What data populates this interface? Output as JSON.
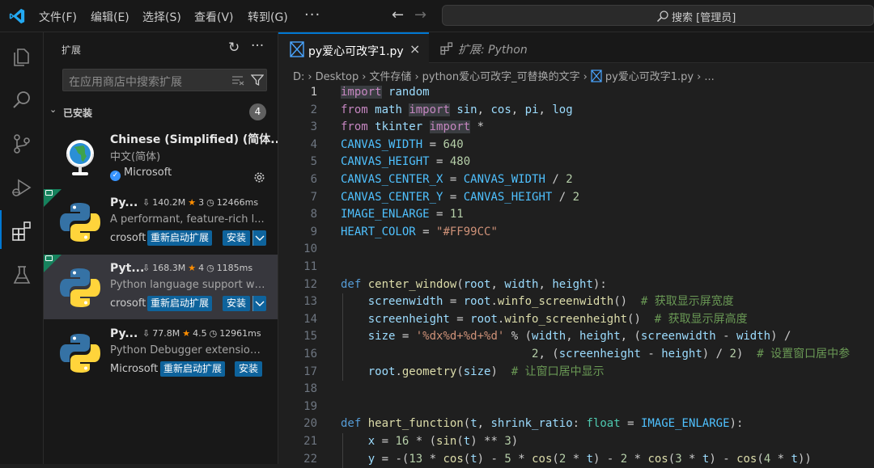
{
  "title_bar": {
    "menu": [
      "文件(F)",
      "编辑(E)",
      "选择(S)",
      "查看(V)",
      "转到(G)"
    ],
    "more": "···",
    "back_arrow": "←",
    "forward_arrow": "→",
    "search": "搜索 [管理员]"
  },
  "activity_bar": {
    "items": [
      "explorer",
      "search",
      "source-control",
      "run-and-debug",
      "extensions",
      "testing"
    ],
    "active": "extensions"
  },
  "sidebar": {
    "title": "扩展",
    "search_placeholder": "在应用商店中搜索扩展",
    "section_label": "已安装",
    "section_count": "4",
    "extensions": [
      {
        "name": "Chinese (Simplified) (简体...",
        "description": "中文(简体)",
        "publisher": "Microsoft",
        "verified": true,
        "icon": "globe-icon"
      },
      {
        "name": "Py...",
        "downloads": "140.2M",
        "rating": "3",
        "time": "12466ms",
        "description": "A performant, feature-rich l...",
        "publisher": "crosoft",
        "restart_label": "重新启动扩展",
        "install_label": "安装",
        "icon": "python-icon"
      },
      {
        "name": "Pyt...",
        "downloads": "168.3M",
        "rating": "4",
        "time": "1185ms",
        "description": "Python language support wi...",
        "publisher": "crosoft",
        "restart_label": "重新启动扩展",
        "install_label": "安装",
        "icon": "python-icon"
      },
      {
        "name": "Py...",
        "downloads": "77.8M",
        "rating": "4.5",
        "time": "12961ms",
        "description": "Python Debugger extension...",
        "publisher": "Microsoft",
        "restart_label": "重新启动扩展",
        "install_label": "安装",
        "icon": "python-icon"
      }
    ]
  },
  "editor": {
    "tabs": [
      {
        "label": "py爱心可改字1.py",
        "active": true,
        "close": "×"
      },
      {
        "label": "扩展: Python",
        "active": false
      }
    ],
    "breadcrumb": [
      "D:",
      "Desktop",
      "文件存储",
      "python爱心可改字_可替换的文字",
      "py爱心可改字1.py",
      "..."
    ],
    "current_line": 1,
    "line_numbers": [
      "1",
      "2",
      "3",
      "4",
      "5",
      "6",
      "7",
      "8",
      "9",
      "10",
      "11",
      "12",
      "13",
      "14",
      "15",
      "16",
      "17",
      "18",
      "19",
      "20",
      "21",
      "22"
    ],
    "code_lines": [
      "import random",
      "from math import sin, cos, pi, log",
      "from tkinter import *",
      "CANVAS_WIDTH = 640",
      "CANVAS_HEIGHT = 480",
      "CANVAS_CENTER_X = CANVAS_WIDTH / 2",
      "CANVAS_CENTER_Y = CANVAS_HEIGHT / 2",
      "IMAGE_ENLARGE = 11",
      "HEART_COLOR = \"#FF99CC\"",
      "",
      "",
      "def center_window(root, width, height):",
      "    screenwidth = root.winfo_screenwidth()  # 获取显示屏宽度",
      "    screenheight = root.winfo_screenheight()  # 获取显示屏高度",
      "    size = '%dx%d+%d+%d' % (width, height, (screenwidth - width) /",
      "                            2, (screenheight - height) / 2)  # 设置窗口居中参",
      "    root.geometry(size)  # 让窗口居中显示",
      "",
      "",
      "def heart_function(t, shrink_ratio: float = IMAGE_ENLARGE):",
      "    x = 16 * (sin(t) ** 3)",
      "    y = -(13 * cos(t) - 5 * cos(2 * t) - 2 * cos(3 * t) - cos(4 * t))"
    ]
  },
  "colors": {
    "accent": "#0078d4",
    "button": "#0e639c",
    "keyword": "#569cd6",
    "import_keyword": "#c586c0",
    "constant": "#4fc1ff",
    "function": "#dcdcaa",
    "number": "#b5cea8",
    "string": "#ce9178",
    "comment": "#6a9955",
    "star": "#ff8e00",
    "badge": "#16825d"
  }
}
